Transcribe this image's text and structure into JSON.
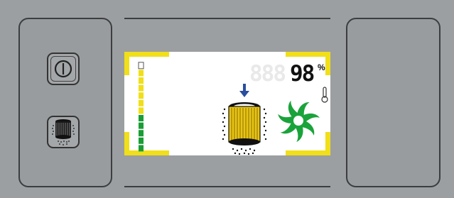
{
  "display": {
    "dim_digits": "888",
    "level_value": "98",
    "level_unit": "%",
    "level_fraction": 0.98
  },
  "icons": {
    "power_button": "power-icon",
    "filter_button": "filter-icon",
    "filter_status": "filter-cartridge-icon",
    "fan_status": "fan-icon",
    "temperature": "thermometer-icon",
    "arrow": "down-arrow-icon"
  },
  "level_bar": {
    "segments_total": 12,
    "segments_lit": 5
  },
  "colors": {
    "frame_yellow": "#f0df19",
    "fan_green": "#1aa33a",
    "bar_green": "#1a9d36",
    "arrow_blue": "#2a4d9e",
    "panel_gray": "#999c9e"
  }
}
